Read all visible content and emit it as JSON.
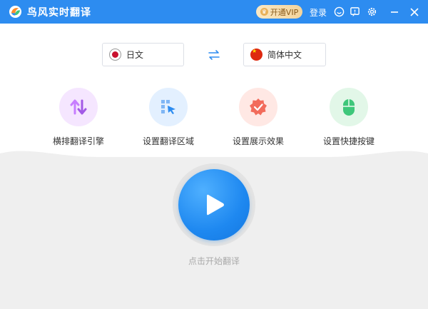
{
  "app": {
    "title": "鸟风实时翻译"
  },
  "titlebar": {
    "vip_label": "开通VIP",
    "login_label": "登录",
    "icons": [
      "chat-icon",
      "feedback-icon",
      "settings-icon",
      "minimize-icon",
      "close-icon"
    ]
  },
  "languages": {
    "source": "日文",
    "target": "简体中文"
  },
  "features": [
    {
      "label": "横排翻译引擎",
      "icon": "sort-arrows-icon",
      "color": "#c77dff"
    },
    {
      "label": "设置翻译区域",
      "icon": "region-select-icon",
      "color": "#2d8cf0"
    },
    {
      "label": "设置展示效果",
      "icon": "badge-check-icon",
      "color": "#f26b5b"
    },
    {
      "label": "设置快捷按键",
      "icon": "mouse-icon",
      "color": "#3ec77a"
    }
  ],
  "start": {
    "label": "点击开始翻译"
  }
}
